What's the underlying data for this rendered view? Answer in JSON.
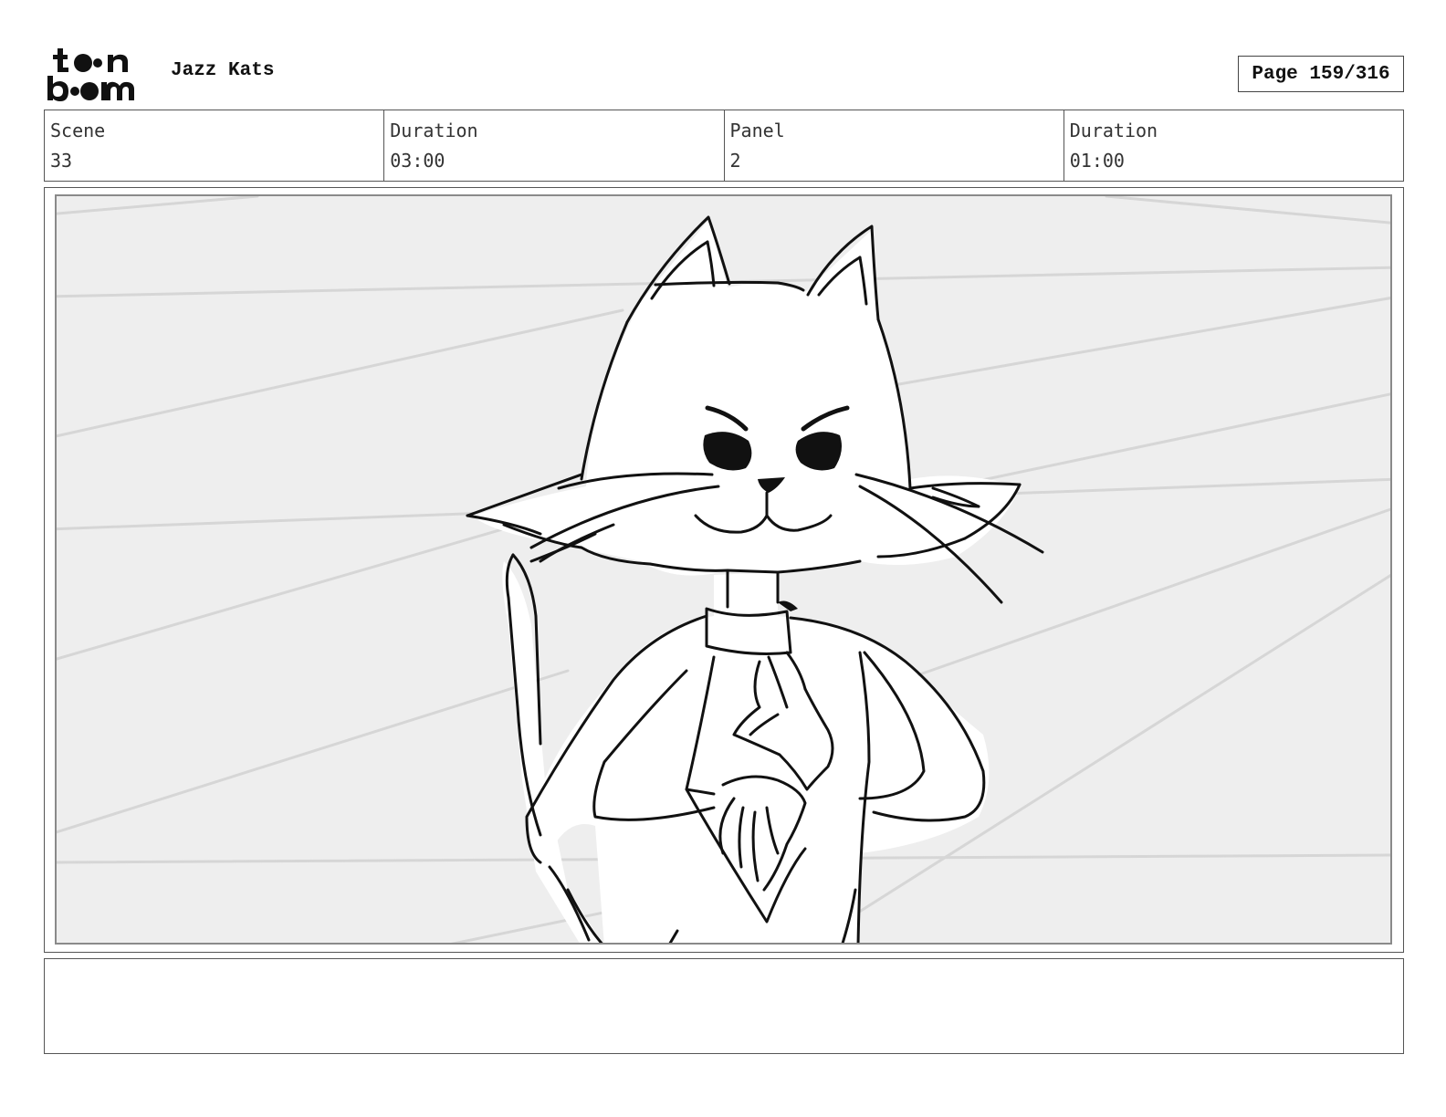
{
  "logo": {
    "line1": "toon",
    "line2": "boom"
  },
  "project": {
    "title": "Jazz Kats"
  },
  "page": {
    "label": "Page 159/316"
  },
  "info": [
    {
      "label": "Scene",
      "value": "33"
    },
    {
      "label": "Duration",
      "value": "03:00"
    },
    {
      "label": "Panel",
      "value": "2"
    },
    {
      "label": "Duration",
      "value": "01:00"
    }
  ],
  "panel": {
    "illustration": "cat-character-sketch"
  },
  "notes": {
    "text": ""
  }
}
